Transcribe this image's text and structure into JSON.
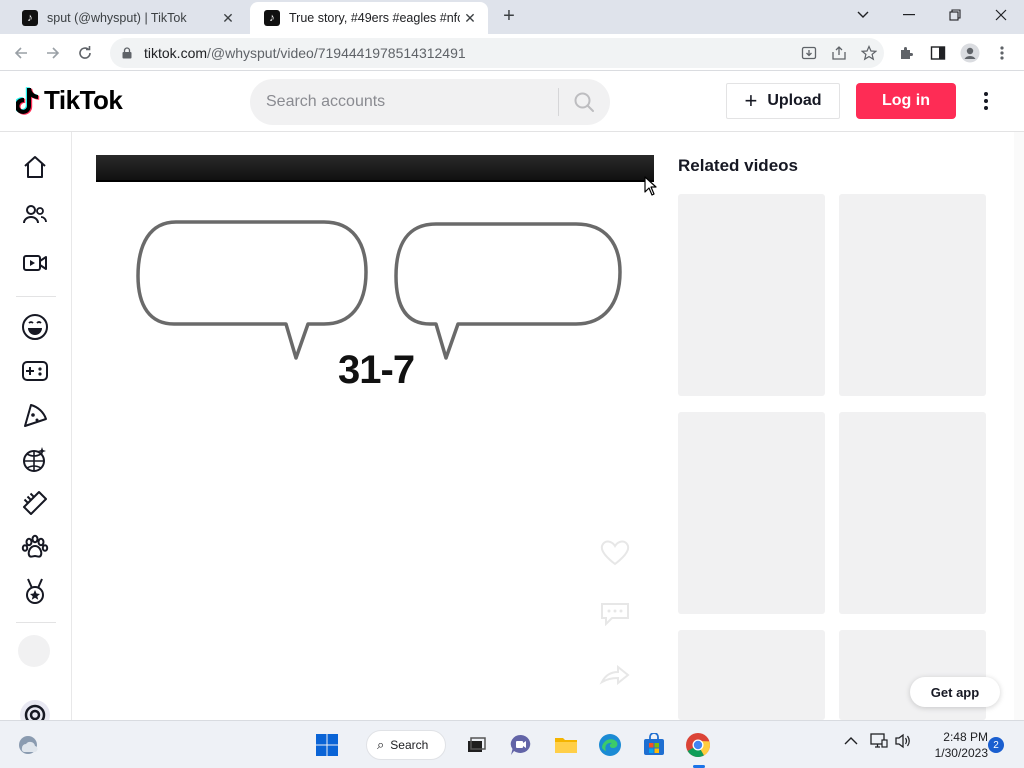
{
  "browser": {
    "tabs": [
      {
        "title": "sput (@whysput) | TikTok",
        "active": false
      },
      {
        "title": "True story, #49ers #eagles #nfc #",
        "active": true
      }
    ],
    "url_host": "tiktok.com",
    "url_path": "/@whysput/video/7194441978514312491"
  },
  "header": {
    "logo_text": "TikTok",
    "search_placeholder": "Search accounts",
    "upload_label": "Upload",
    "login_label": "Log in"
  },
  "video": {
    "score_text": "31-7"
  },
  "related": {
    "title": "Related videos",
    "get_app_label": "Get app"
  },
  "taskbar": {
    "search_label": "Search",
    "time": "2:48 PM",
    "date": "1/30/2023",
    "notification_count": "2"
  },
  "colors": {
    "brand_red": "#fe2c55",
    "placeholder_gray": "#f1f1f2"
  }
}
